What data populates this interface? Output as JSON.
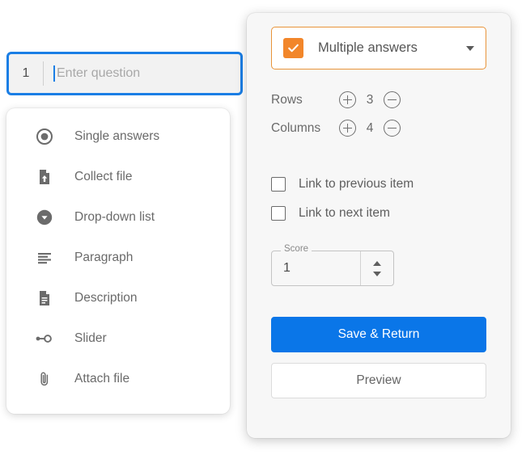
{
  "question_row": {
    "number": "1",
    "placeholder": "Enter question",
    "value": ""
  },
  "type_menu": {
    "items": [
      {
        "label": "Single answers",
        "icon": "radio-button-icon"
      },
      {
        "label": "Collect file",
        "icon": "file-upload-icon"
      },
      {
        "label": "Drop-down list",
        "icon": "dropdown-circle-icon"
      },
      {
        "label": "Paragraph",
        "icon": "paragraph-lines-icon"
      },
      {
        "label": "Description",
        "icon": "document-text-icon"
      },
      {
        "label": "Slider",
        "icon": "slider-icon"
      },
      {
        "label": "Attach file",
        "icon": "paperclip-icon"
      }
    ]
  },
  "settings": {
    "type_select": {
      "label": "Multiple answers",
      "checkbox_checked": true,
      "accent_color": "#f2862a",
      "border_color": "#e8943a"
    },
    "steppers": [
      {
        "label": "Rows",
        "value": "3",
        "increase": "+",
        "decrease": "−"
      },
      {
        "label": "Columns",
        "value": "4",
        "increase": "+",
        "decrease": "−"
      }
    ],
    "link_options": [
      {
        "label": "Link to previous item",
        "checked": false
      },
      {
        "label": "Link to next item",
        "checked": false
      }
    ],
    "score": {
      "legend": "Score",
      "value": "1"
    },
    "actions": {
      "primary_label": "Save & Return",
      "secondary_label": "Preview",
      "primary_color": "#0a76e8"
    }
  }
}
